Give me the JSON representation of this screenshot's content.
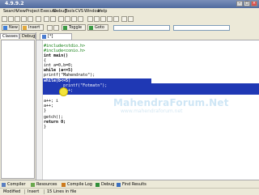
{
  "window": {
    "title": "4.9.9.2"
  },
  "menu": {
    "items": [
      "Search",
      "View",
      "Project",
      "Execute",
      "Debug",
      "Tools",
      "CVS",
      "Window",
      "Help"
    ]
  },
  "toolbar2": {
    "new_label": "New",
    "insert_label": "Insert",
    "toggle_label": "Toggle",
    "goto_label": "Goto"
  },
  "left_panel": {
    "tabs": [
      "Classes",
      "Debug"
    ]
  },
  "editor": {
    "tab_label": "[*] devc.cpp",
    "lines": [
      "#include<stdio.h>",
      "#include<conio.h>",
      "int main()",
      "{",
      "int a=0,b=0;",
      "while (a<=5)",
      "printf(\"Mahendrato\");",
      "",
      "while(b<=5)",
      "        printf(\"Fotmatn\");",
      "        b++;",
      "",
      "a++; i",
      "a++;",
      "}",
      "getch();",
      "return 0;",
      "}"
    ]
  },
  "watermark": {
    "main": "MahendraForum.Net",
    "sub": "www.mahendraforum.net"
  },
  "bottom_tabs": {
    "items": [
      "Compiler",
      "Resources",
      "Compile Log",
      "Debug",
      "Find Results"
    ]
  },
  "status": {
    "position": "Modified",
    "mode": "Insert",
    "lines": "15 Lines in file"
  },
  "colors": {
    "selection": "#1f38b4",
    "chrome": "#ece9d8"
  }
}
